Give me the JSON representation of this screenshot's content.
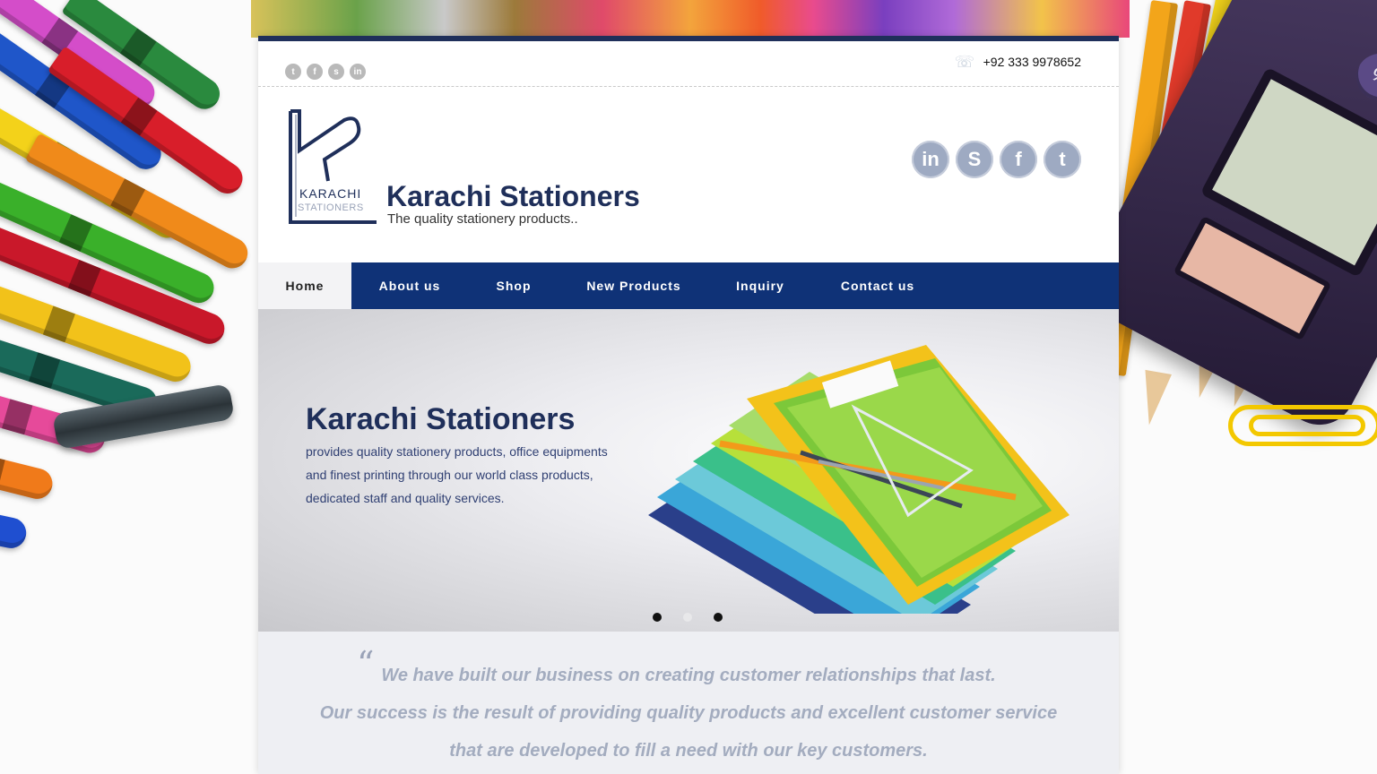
{
  "topbar": {
    "mini_social": [
      "twitter-icon",
      "facebook-icon",
      "skype-icon",
      "linkedin-icon"
    ],
    "phone": "+92 333 9978652"
  },
  "logo": {
    "mark_word": "KARACHI",
    "mark_sub": "STATIONERS",
    "name": "Karachi Stationers",
    "tagline": "The quality stationery products.."
  },
  "social": {
    "items": [
      {
        "icon": "linkedin-icon",
        "glyph": "in"
      },
      {
        "icon": "skype-icon",
        "glyph": "S"
      },
      {
        "icon": "facebook-icon",
        "glyph": "f"
      },
      {
        "icon": "twitter-icon",
        "glyph": "t"
      }
    ]
  },
  "nav": {
    "items": [
      {
        "label": "Home",
        "active": true
      },
      {
        "label": "About us"
      },
      {
        "label": "Shop"
      },
      {
        "label": "New Products"
      },
      {
        "label": "Inquiry"
      },
      {
        "label": "Contact us"
      }
    ]
  },
  "hero": {
    "title": "Karachi Stationers",
    "text": "provides quality stationery products, office equipments and finest printing through our world class products, dedicated staff and quality services.",
    "slides": 3,
    "active_slide": 2
  },
  "quote": {
    "mark": "“",
    "lines": [
      "We have built our business on creating customer relationships that last.",
      "Our success is the result of providing quality products and excellent customer service",
      "that are developed to fill a need with our key customers."
    ]
  },
  "calculator": {
    "keys": [
      "×",
      "%",
      "✓"
    ]
  },
  "colors": {
    "brand_navy": "#1f2f5a",
    "nav_blue": "#0f3277",
    "icon_gray": "#9eaac2"
  }
}
